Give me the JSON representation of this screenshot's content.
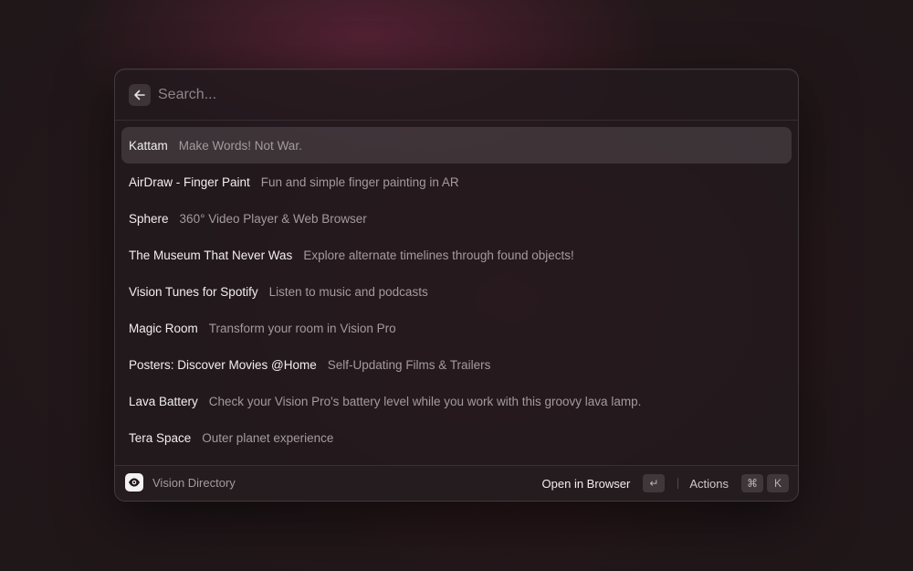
{
  "search": {
    "placeholder": "Search...",
    "value": ""
  },
  "results": [
    {
      "title": "Kattam",
      "subtitle": "Make Words! Not War.",
      "selected": true
    },
    {
      "title": "AirDraw - Finger Paint",
      "subtitle": "Fun and simple finger painting in AR"
    },
    {
      "title": "Sphere",
      "subtitle": "360° Video Player & Web Browser"
    },
    {
      "title": "The Museum That Never Was",
      "subtitle": "Explore alternate timelines through found objects!"
    },
    {
      "title": "Vision Tunes for Spotify",
      "subtitle": "Listen to music and podcasts"
    },
    {
      "title": "Magic Room",
      "subtitle": "Transform your room in Vision Pro"
    },
    {
      "title": "Posters: Discover Movies @Home",
      "subtitle": "Self-Updating Films & Trailers"
    },
    {
      "title": "Lava Battery",
      "subtitle": "Check your Vision Pro's battery level while you work with this groovy lava lamp."
    },
    {
      "title": "Tera Space",
      "subtitle": "Outer planet experience"
    }
  ],
  "footer": {
    "app_name": "Vision Directory",
    "app_icon": "eye-icon",
    "primary_action": "Open in Browser",
    "primary_shortcut": "↵",
    "actions_label": "Actions",
    "actions_shortcut": [
      "⌘",
      "K"
    ]
  },
  "colors": {
    "selected_row": "#3a3134",
    "title_text": "#f2eef0",
    "subtitle_text": "#a39b9e"
  }
}
